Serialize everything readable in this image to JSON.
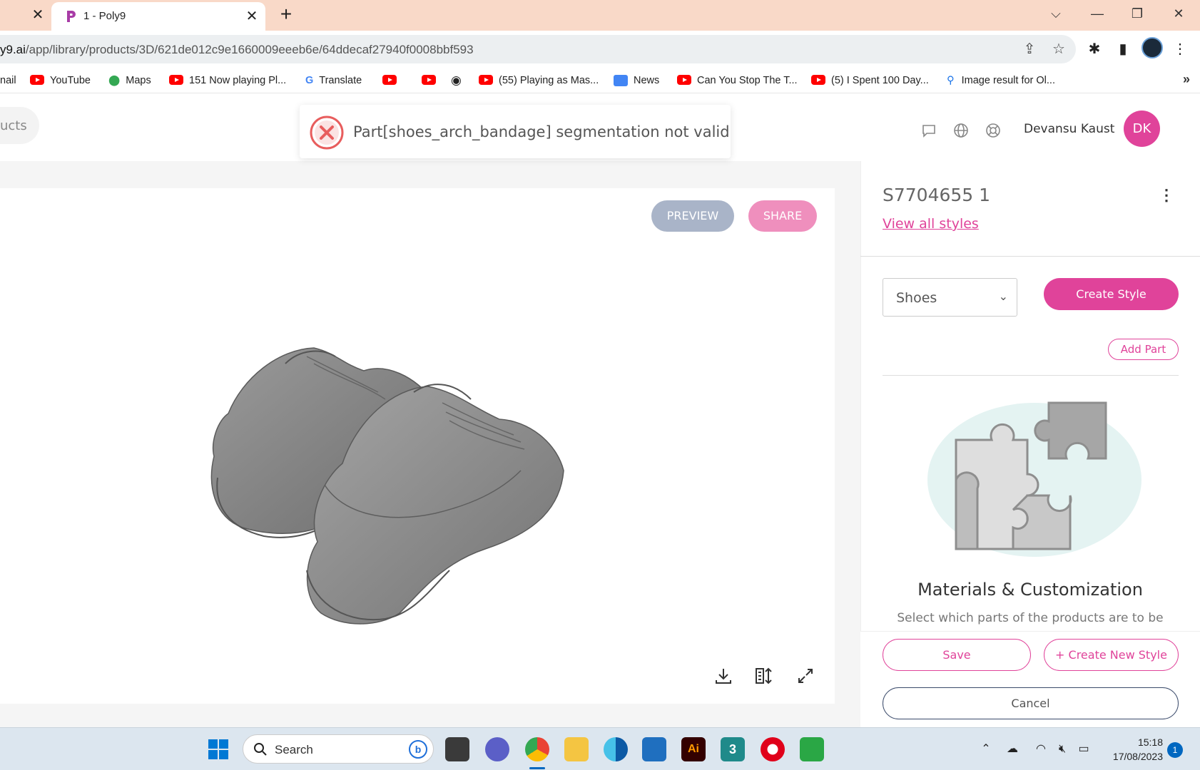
{
  "browser": {
    "tab_title": "1 - Poly9",
    "url_host": "y9.ai",
    "url_path": "/app/library/products/3D/621de012c9e1660009eeeb6e/64ddecaf27940f0008bbf593",
    "bookmarks": [
      {
        "label": "nail",
        "icon": "mail-icon"
      },
      {
        "label": "YouTube",
        "icon": "youtube-icon"
      },
      {
        "label": "Maps",
        "icon": "maps-icon"
      },
      {
        "label": "151 Now playing Pl...",
        "icon": "youtube-icon"
      },
      {
        "label": "Translate",
        "icon": "translate-icon"
      },
      {
        "label": "",
        "icon": "youtube-icon"
      },
      {
        "label": "",
        "icon": "youtube-icon"
      },
      {
        "label": "",
        "icon": "globe-icon"
      },
      {
        "label": "(55) Playing as Mas...",
        "icon": "youtube-icon"
      },
      {
        "label": "News",
        "icon": "news-icon"
      },
      {
        "label": "Can You Stop The T...",
        "icon": "youtube-icon"
      },
      {
        "label": "(5) I Spent 100 Day...",
        "icon": "youtube-icon"
      },
      {
        "label": "Image result for Ol...",
        "icon": "search-icon"
      }
    ]
  },
  "header": {
    "search_fragment": "ucts",
    "user_name": "Devansu Kaust",
    "avatar_initials": "DK"
  },
  "toast": {
    "message": "Part[shoes_arch_bandage] segmentation not valid",
    "type": "error"
  },
  "viewer": {
    "preview_label": "PREVIEW",
    "share_label": "SHARE"
  },
  "panel": {
    "product_code": "S7704655 1",
    "view_all_label": "View all styles",
    "category_value": "Shoes",
    "create_style_label": "Create Style",
    "add_part_label": "Add Part",
    "mc_title": "Materials & Customization",
    "mc_subtitle": "Select which parts of the products are to be",
    "save_label": "Save",
    "create_new_style_label": "+ Create New Style",
    "cancel_label": "Cancel"
  },
  "taskbar": {
    "search_label": "Search",
    "time": "15:18",
    "date": "17/08/2023",
    "notification_count": "1"
  },
  "colors": {
    "accent": "#e0439a",
    "preview_button": "#a9b4c8",
    "share_button": "#ef8fbd",
    "tab_strip": "#f9d9c8",
    "error": "#e85d5d"
  }
}
